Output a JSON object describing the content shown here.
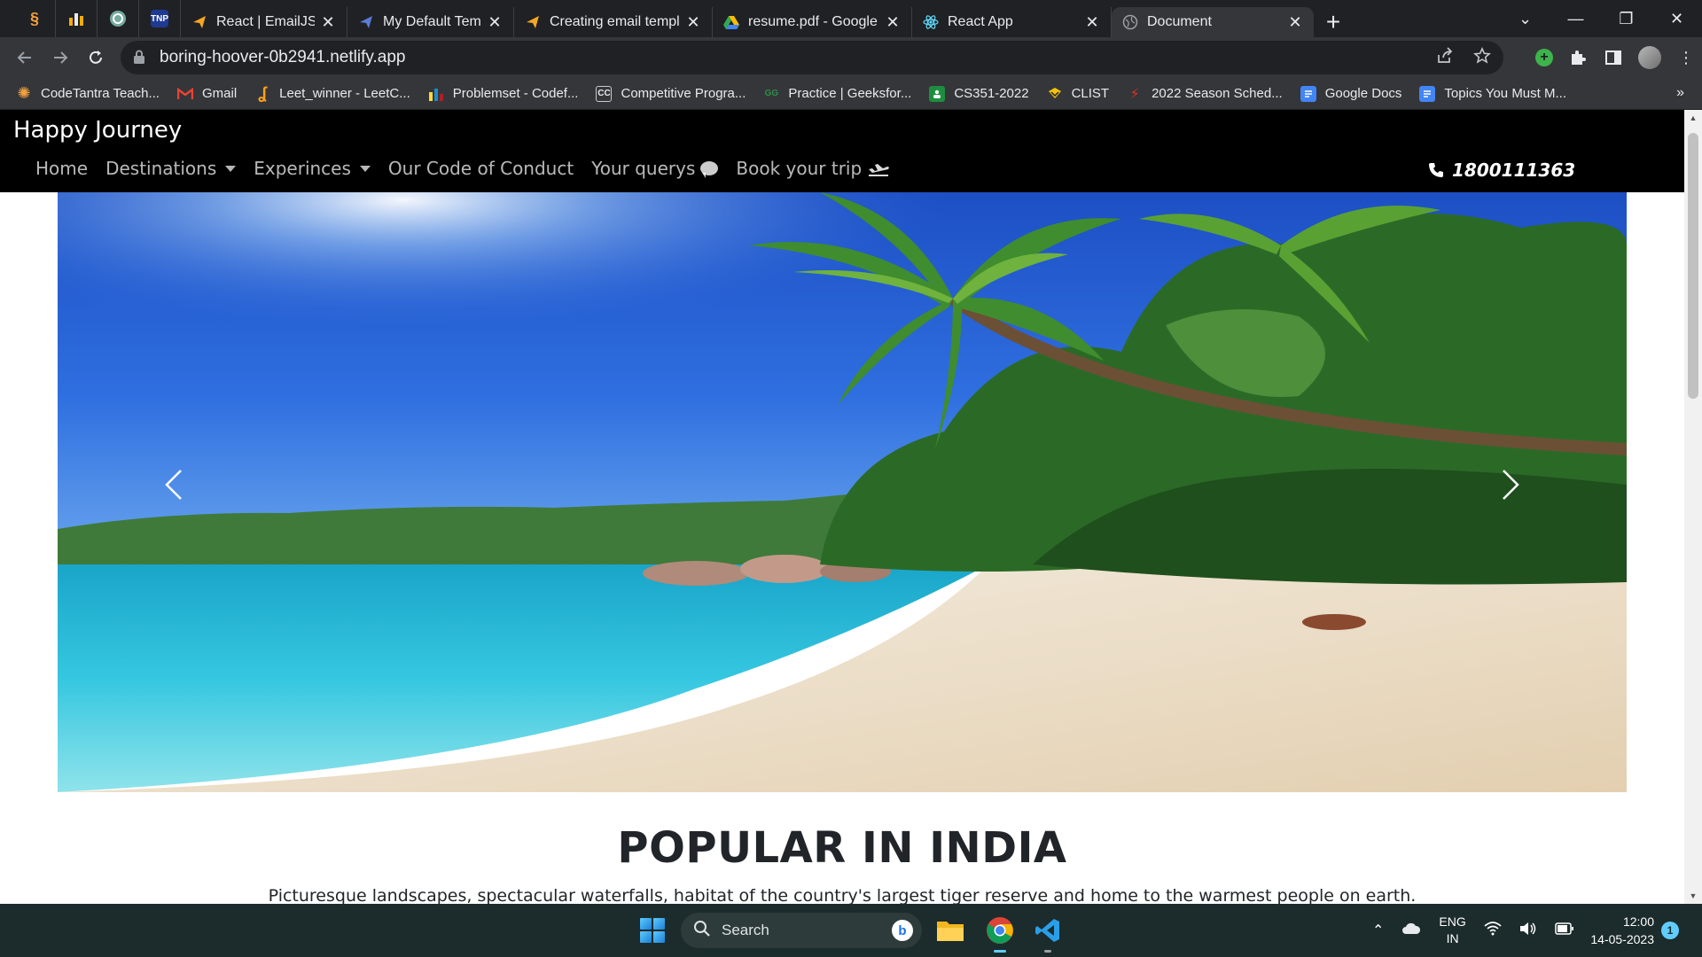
{
  "browser": {
    "pinned_tabs": [
      {
        "icon": "codetantra-icon",
        "color": "#f0a040"
      },
      {
        "icon": "bar-chart-icon",
        "color": "#f9ab00"
      },
      {
        "icon": "chatgpt-icon",
        "color": "#74aa9c"
      },
      {
        "icon": "tnp-icon",
        "label": "TNP",
        "color": "#1f3a93"
      }
    ],
    "tabs": [
      {
        "label": "React | EmailJS",
        "icon": "emailjs-icon",
        "color": "#f5a623"
      },
      {
        "label": "My Default Template -",
        "icon": "emailjs-template-icon",
        "color": "#5b7bd5"
      },
      {
        "label": "Creating email templat",
        "icon": "emailjs-icon",
        "color": "#f5a623"
      },
      {
        "label": "resume.pdf - Google D",
        "icon": "google-drive-icon",
        "color": "#34a853"
      },
      {
        "label": "React App",
        "icon": "react-icon",
        "color": "#61dafb"
      },
      {
        "label": "Document",
        "icon": "globe-icon",
        "color": "#9aa0a6",
        "active": true
      }
    ],
    "url": "boring-hoover-0b2941.netlify.app",
    "bookmarks": [
      {
        "label": "CodeTantra Teach...",
        "icon": "codetantra-icon",
        "color": "#f0a040"
      },
      {
        "label": "Gmail",
        "icon": "gmail-icon",
        "color": "#ea4335"
      },
      {
        "label": "Leet_winner - LeetC...",
        "icon": "leetcode-icon",
        "color": "#ffa116"
      },
      {
        "label": "Problemset - Codef...",
        "icon": "codeforces-icon",
        "color": "#1f8acb"
      },
      {
        "label": "Competitive Progra...",
        "icon": "cc-icon",
        "color": "#c9c9c9",
        "glyph": "CC"
      },
      {
        "label": "Practice | Geeksfor...",
        "icon": "gfg-icon",
        "color": "#2f8d46",
        "glyph": "GG"
      },
      {
        "label": "CS351-2022",
        "icon": "classroom-icon",
        "color": "#1e8e3e"
      },
      {
        "label": "CLIST",
        "icon": "clist-icon",
        "color": "#f4c20d"
      },
      {
        "label": "2022 Season Sched...",
        "icon": "season-icon",
        "color": "#d93025"
      },
      {
        "label": "Google Docs",
        "icon": "google-docs-icon",
        "color": "#4285f4"
      },
      {
        "label": "Topics You Must M...",
        "icon": "google-docs-icon",
        "color": "#4285f4"
      }
    ]
  },
  "site": {
    "brand": "Happy Journey",
    "nav": [
      {
        "label": "Home"
      },
      {
        "label": "Destinations",
        "dropdown": true
      },
      {
        "label": "Experinces",
        "dropdown": true
      },
      {
        "label": "Our Code of Conduct"
      },
      {
        "label": "Your querys",
        "icon": "chat-bubble-icon"
      },
      {
        "label": "Book your trip",
        "icon": "plane-icon"
      }
    ],
    "phone": "1800111363",
    "section_title": "POPULAR IN INDIA",
    "section_text": "Picturesque landscapes, spectacular waterfalls, habitat of the country's largest tiger reserve and home to the warmest people on earth."
  },
  "taskbar": {
    "search_placeholder": "Search",
    "language": "ENG",
    "region": "IN",
    "time": "12:00",
    "date": "14-05-2023",
    "notifications": "1"
  }
}
